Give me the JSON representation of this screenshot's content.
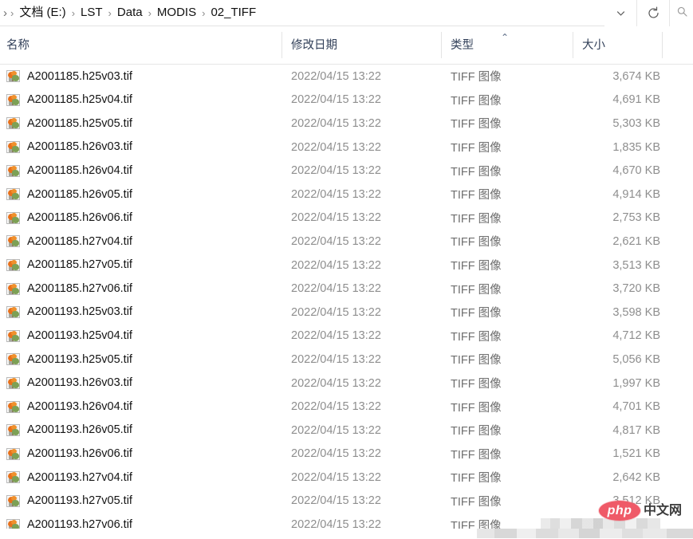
{
  "addressbar": {
    "overflow_chevron": "›",
    "separator": "›",
    "crumbs": [
      {
        "label": "文档 (E:)"
      },
      {
        "label": "LST"
      },
      {
        "label": "Data"
      },
      {
        "label": "MODIS"
      },
      {
        "label": "02_TIFF"
      }
    ],
    "history_dropdown_icon": "chevron-down-icon",
    "refresh_icon": "refresh-icon",
    "search_icon": "search-icon"
  },
  "columns": {
    "name": "名称",
    "date_modified": "修改日期",
    "type": "类型",
    "size": "大小",
    "sort_caret": "⌃"
  },
  "files": [
    {
      "name": "A2001185.h25v03.tif",
      "date": "2022/04/15 13:22",
      "type": "TIFF 图像",
      "size": "3,674 KB"
    },
    {
      "name": "A2001185.h25v04.tif",
      "date": "2022/04/15 13:22",
      "type": "TIFF 图像",
      "size": "4,691 KB"
    },
    {
      "name": "A2001185.h25v05.tif",
      "date": "2022/04/15 13:22",
      "type": "TIFF 图像",
      "size": "5,303 KB"
    },
    {
      "name": "A2001185.h26v03.tif",
      "date": "2022/04/15 13:22",
      "type": "TIFF 图像",
      "size": "1,835 KB"
    },
    {
      "name": "A2001185.h26v04.tif",
      "date": "2022/04/15 13:22",
      "type": "TIFF 图像",
      "size": "4,670 KB"
    },
    {
      "name": "A2001185.h26v05.tif",
      "date": "2022/04/15 13:22",
      "type": "TIFF 图像",
      "size": "4,914 KB"
    },
    {
      "name": "A2001185.h26v06.tif",
      "date": "2022/04/15 13:22",
      "type": "TIFF 图像",
      "size": "2,753 KB"
    },
    {
      "name": "A2001185.h27v04.tif",
      "date": "2022/04/15 13:22",
      "type": "TIFF 图像",
      "size": "2,621 KB"
    },
    {
      "name": "A2001185.h27v05.tif",
      "date": "2022/04/15 13:22",
      "type": "TIFF 图像",
      "size": "3,513 KB"
    },
    {
      "name": "A2001185.h27v06.tif",
      "date": "2022/04/15 13:22",
      "type": "TIFF 图像",
      "size": "3,720 KB"
    },
    {
      "name": "A2001193.h25v03.tif",
      "date": "2022/04/15 13:22",
      "type": "TIFF 图像",
      "size": "3,598 KB"
    },
    {
      "name": "A2001193.h25v04.tif",
      "date": "2022/04/15 13:22",
      "type": "TIFF 图像",
      "size": "4,712 KB"
    },
    {
      "name": "A2001193.h25v05.tif",
      "date": "2022/04/15 13:22",
      "type": "TIFF 图像",
      "size": "5,056 KB"
    },
    {
      "name": "A2001193.h26v03.tif",
      "date": "2022/04/15 13:22",
      "type": "TIFF 图像",
      "size": "1,997 KB"
    },
    {
      "name": "A2001193.h26v04.tif",
      "date": "2022/04/15 13:22",
      "type": "TIFF 图像",
      "size": "4,701 KB"
    },
    {
      "name": "A2001193.h26v05.tif",
      "date": "2022/04/15 13:22",
      "type": "TIFF 图像",
      "size": "4,817 KB"
    },
    {
      "name": "A2001193.h26v06.tif",
      "date": "2022/04/15 13:22",
      "type": "TIFF 图像",
      "size": "1,521 KB"
    },
    {
      "name": "A2001193.h27v04.tif",
      "date": "2022/04/15 13:22",
      "type": "TIFF 图像",
      "size": "2,642 KB"
    },
    {
      "name": "A2001193.h27v05.tif",
      "date": "2022/04/15 13:22",
      "type": "TIFF 图像",
      "size": "3,512 KB"
    },
    {
      "name": "A2001193.h27v06.tif",
      "date": "2022/04/15 13:22",
      "type": "TIFF 图像",
      "size": "",
      "size_censored": true
    }
  ],
  "watermark": {
    "logo_text": "php",
    "site_text": "中文网",
    "logo_color": "#ef5a68"
  }
}
